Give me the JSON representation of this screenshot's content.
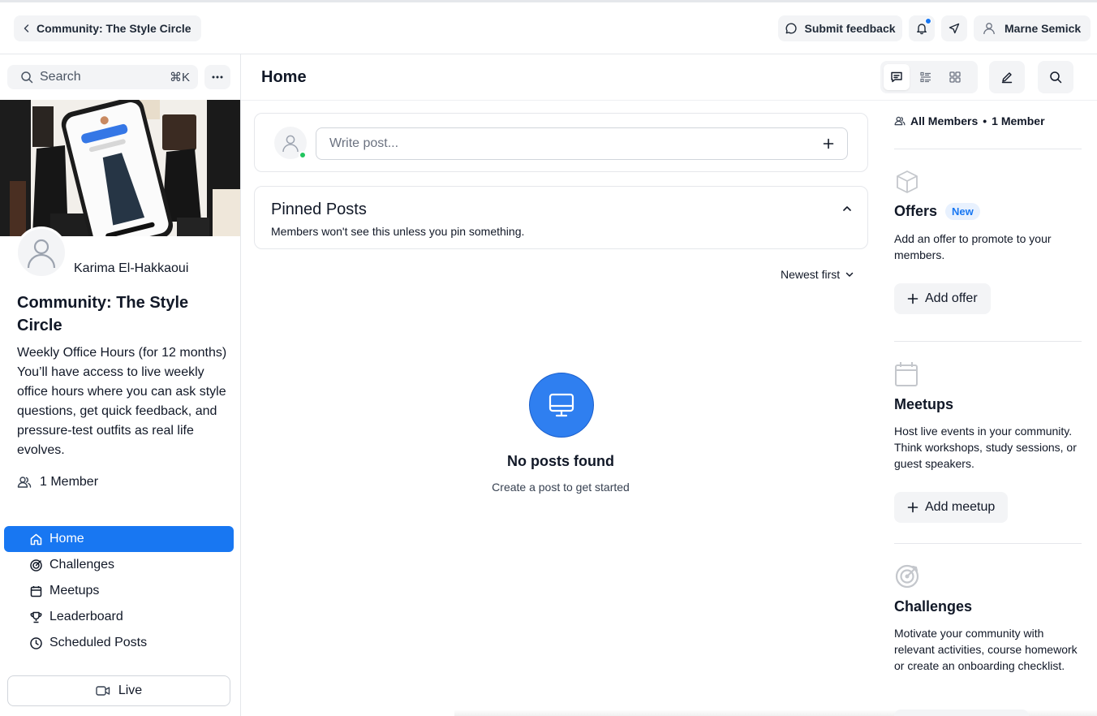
{
  "topbar": {
    "breadcrumb": "Community: The Style Circle",
    "feedback_label": "Submit feedback",
    "user_name": "Marne Semick"
  },
  "sidebar": {
    "search_placeholder": "Search",
    "search_shortcut": "⌘K",
    "owner_name": "Karima El-Hakkaoui",
    "community_title": "Community: The Style Circle",
    "description": "Weekly Office Hours (for 12 months) You’ll have access to live weekly office hours where you can ask style questions, get quick feedback, and pressure-test outfits as real life evolves.",
    "member_count": "1 Member",
    "nav": [
      {
        "label": "Home",
        "icon": "home-icon",
        "active": true
      },
      {
        "label": "Challenges",
        "icon": "target-icon",
        "active": false
      },
      {
        "label": "Meetups",
        "icon": "calendar-icon",
        "active": false
      },
      {
        "label": "Leaderboard",
        "icon": "trophy-icon",
        "active": false
      },
      {
        "label": "Scheduled Posts",
        "icon": "clock-icon",
        "active": false
      }
    ],
    "live_label": "Live"
  },
  "main": {
    "title": "Home",
    "composer_placeholder": "Write post...",
    "pinned_title": "Pinned Posts",
    "pinned_desc": "Members won't see this unless you pin something.",
    "sort_label": "Newest first",
    "empty_title": "No posts found",
    "empty_subtitle": "Create a post to get started"
  },
  "right": {
    "audience": "All Members",
    "audience_count": "1 Member",
    "offers": {
      "title": "Offers",
      "badge": "New",
      "desc": "Add an offer to promote to your members.",
      "button": "Add offer"
    },
    "meetups": {
      "title": "Meetups",
      "desc": "Host live events in your community. Think workshops, study sessions, or guest speakers.",
      "button": "Add meetup"
    },
    "challenges": {
      "title": "Challenges",
      "desc": "Motivate your community with relevant activities, course homework or create an onboarding checklist."
    }
  },
  "colors": {
    "accent": "#1877f2",
    "online": "#22c55e",
    "empty_icon_bg": "#2f7ff0"
  }
}
